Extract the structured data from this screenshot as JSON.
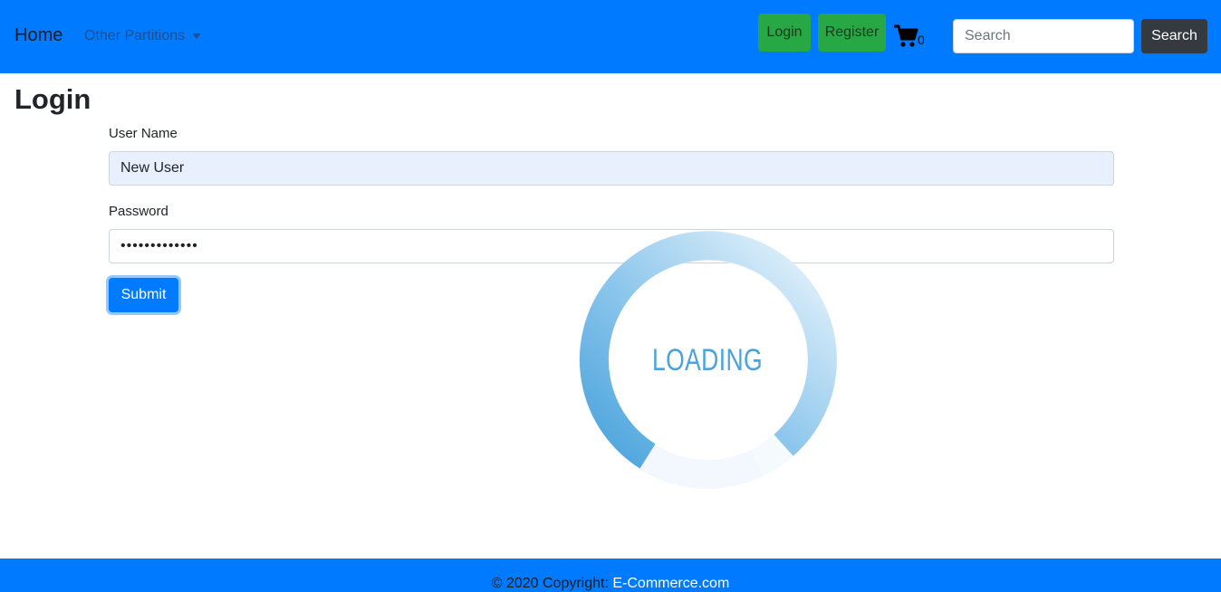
{
  "navbar": {
    "brand": "Home",
    "dropdown_label": "Other Partitions",
    "login_label": "Login",
    "register_label": "Register",
    "cart_count": "0",
    "search_placeholder": "Search",
    "search_button": "Search"
  },
  "page": {
    "title": "Login"
  },
  "form": {
    "username_label": "User Name",
    "username_value": "New User",
    "password_label": "Password",
    "password_value": "•••••••••••••",
    "submit_label": "Submit"
  },
  "loader": {
    "text": "LOADING"
  },
  "footer": {
    "copyright": "© 2020 Copyright: ",
    "link": "E-Commerce.com"
  },
  "colors": {
    "navbar": "#007bff",
    "success": "#28a745",
    "dark": "#343a40",
    "loader": "#4aa3dc"
  }
}
